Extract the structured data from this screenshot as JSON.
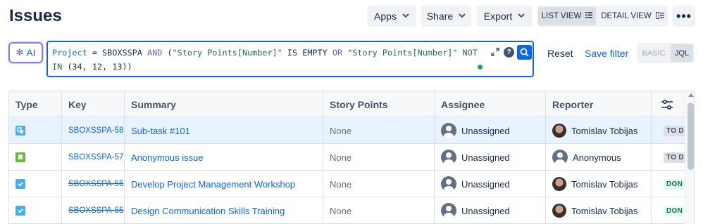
{
  "header": {
    "title": "Issues",
    "apps_label": "Apps",
    "share_label": "Share",
    "export_label": "Export",
    "list_view_label": "LIST VIEW",
    "detail_view_label": "DETAIL VIEW",
    "more_label": "•••"
  },
  "search": {
    "ai_label": "AI",
    "jql": {
      "line1": {
        "project_field": "Project",
        "eq": "=",
        "project_value": "SBOXSSPA",
        "and": "AND",
        "lparen": "(",
        "field1": "\"Story Points[Number]\"",
        "is": "IS",
        "empty": "EMPTY",
        "or": "OR",
        "field2": "\"Story Points[Number]\"",
        "not": "NOT"
      },
      "line2": {
        "in": "IN",
        "values": "(34, 12, 13))"
      }
    },
    "reset_label": "Reset",
    "save_filter_label": "Save filter",
    "mode_basic_label": "BASIC",
    "mode_jql_label": "JQL"
  },
  "table": {
    "columns": [
      "Type",
      "Key",
      "Summary",
      "Story Points",
      "Assignee",
      "Reporter"
    ],
    "rows": [
      {
        "type": "subtask",
        "key": "SBOXSSPA-58",
        "summary": "Sub-task #101",
        "story_points": "None",
        "assignee": "Unassigned",
        "reporter": "Tomislav Tobijas",
        "status": "TO D",
        "done": false,
        "selected": true
      },
      {
        "type": "story",
        "key": "SBOXSSPA-57",
        "summary": "Anonymous issue",
        "story_points": "None",
        "assignee": "Unassigned",
        "reporter": "Anonymous",
        "status": "TO D",
        "done": false,
        "selected": false
      },
      {
        "type": "task",
        "key": "SBOXSSPA-56",
        "summary": "Develop Project Management Workshop",
        "story_points": "None",
        "assignee": "Unassigned",
        "reporter": "Tomislav Tobijas",
        "status": "DON",
        "done": true,
        "selected": false
      },
      {
        "type": "task",
        "key": "SBOXSSPA-55",
        "summary": "Design Communication Skills Training",
        "story_points": "None",
        "assignee": "Unassigned",
        "reporter": "Tomislav Tobijas",
        "status": "DON",
        "done": true,
        "selected": false
      }
    ]
  },
  "colors": {
    "accent": "#0c66e4",
    "subtask": "#4bade8",
    "story": "#63ba3c",
    "task": "#4bade8"
  }
}
